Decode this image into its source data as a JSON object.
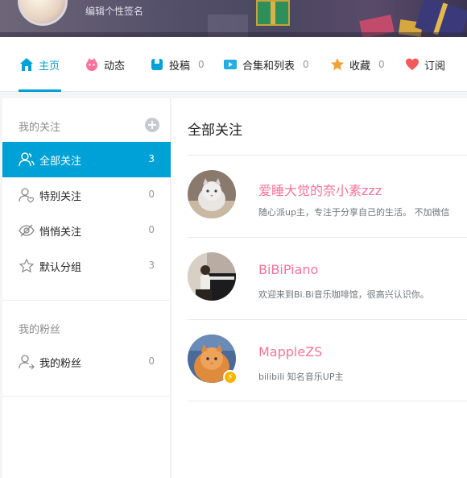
{
  "banner": {
    "signature": "编辑个性签名"
  },
  "tabs": [
    {
      "label": "主页",
      "count": "",
      "color": "#00a1d6",
      "icon": "home-icon",
      "active": true
    },
    {
      "label": "动态",
      "count": "",
      "color": "#fb7299",
      "icon": "dynamic-icon"
    },
    {
      "label": "投稿",
      "count": "0",
      "color": "#00a1d6",
      "icon": "upload-icon"
    },
    {
      "label": "合集和列表",
      "count": "0",
      "color": "#23ade5",
      "icon": "collection-icon"
    },
    {
      "label": "收藏",
      "count": "0",
      "color": "#f3a034",
      "icon": "favorite-icon"
    },
    {
      "label": "订阅",
      "count": "",
      "color": "#f45a5a",
      "icon": "heart-icon"
    }
  ],
  "sidebar": {
    "follow_title": "我的关注",
    "follow_items": [
      {
        "label": "全部关注",
        "count": "3",
        "icon": "all-follow-icon",
        "active": true
      },
      {
        "label": "特别关注",
        "count": "0",
        "icon": "special-follow-icon"
      },
      {
        "label": "悄悄关注",
        "count": "0",
        "icon": "hidden-follow-icon"
      },
      {
        "label": "默认分组",
        "count": "3",
        "icon": "default-group-icon"
      }
    ],
    "fans_title": "我的粉丝",
    "fans_items": [
      {
        "label": "我的粉丝",
        "count": "0",
        "icon": "fans-icon"
      }
    ]
  },
  "main": {
    "title": "全部关注",
    "users": [
      {
        "name": "爱睡大觉的奈小素zzz",
        "desc": "随心派up主，专注于分享自己的生活。 不加微信",
        "avatar": "cat-avatar"
      },
      {
        "name": "BiBiPiano",
        "desc": "欢迎来到Bi.Bi音乐咖啡馆，很高兴认识你。",
        "avatar": "piano-avatar"
      },
      {
        "name": "MappleZS",
        "desc": "bilibili 知名音乐UP主",
        "avatar": "orange-cat-avatar",
        "verified": true
      }
    ]
  },
  "accent": "#00a1d6",
  "name_color": "#fb7299"
}
